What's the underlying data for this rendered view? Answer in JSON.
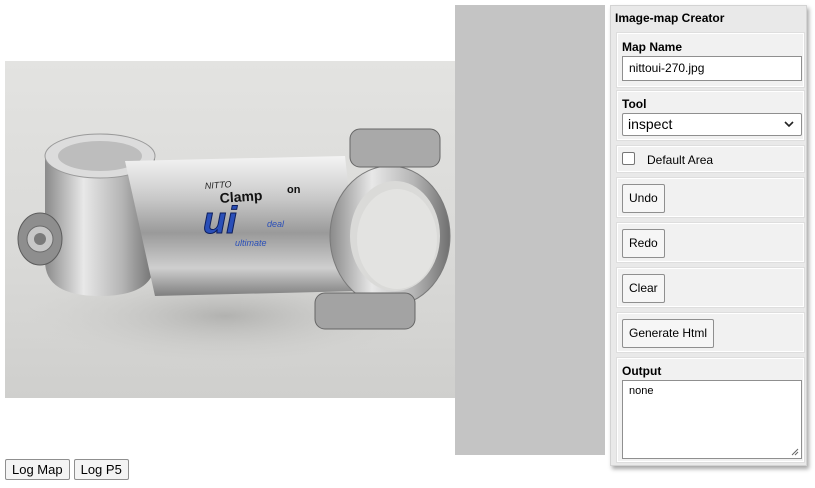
{
  "panel": {
    "title": "Image-map Creator",
    "map_name": {
      "label": "Map Name",
      "value": "nittoui-270.jpg"
    },
    "tool": {
      "label": "Tool",
      "selected": "inspect"
    },
    "default_area": {
      "label": "Default Area",
      "checked": false
    },
    "undo_label": "Undo",
    "redo_label": "Redo",
    "clear_label": "Clear",
    "generate_label": "Generate Html",
    "output": {
      "label": "Output",
      "value": "none"
    }
  },
  "image": {
    "brand": "NITTO",
    "text_clamp": "Clamp",
    "text_on": "on",
    "logo": "ui",
    "logo_small": "deal",
    "logo_under": "ultimate"
  },
  "bottom": {
    "log_map_label": "Log Map",
    "log_p5_label": "Log P5"
  },
  "colors": {
    "canvas_gray": "#c4c4c4",
    "panel_bg": "#e9e9e9",
    "logo_blue": "#2a4fb8"
  }
}
